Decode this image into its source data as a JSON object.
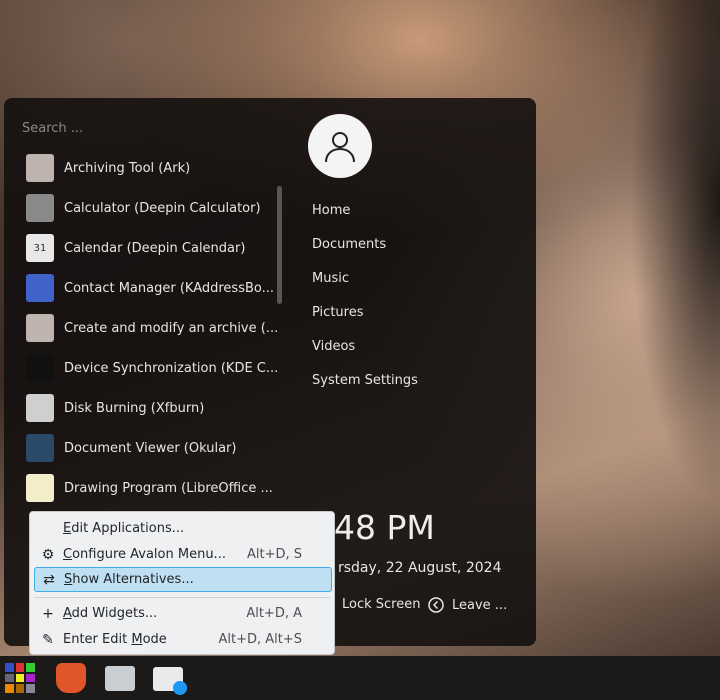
{
  "search": {
    "placeholder": "Search ..."
  },
  "apps": [
    {
      "label": "Archiving Tool (Ark)",
      "icon": "archive-icon",
      "color": "#bfb3ad"
    },
    {
      "label": "Calculator (Deepin Calculator)",
      "icon": "calculator-icon",
      "color": "#8a8a8a"
    },
    {
      "label": "Calendar (Deepin Calendar)",
      "icon": "calendar-icon",
      "color": "#e8e8e8",
      "text": "31"
    },
    {
      "label": "Contact Manager (KAddressBo...",
      "icon": "contact-icon",
      "color": "#3f63c9"
    },
    {
      "label": "Create and modify an archive (...",
      "icon": "archive-icon",
      "color": "#bfb3ad"
    },
    {
      "label": "Device Synchronization (KDE C...",
      "icon": "kde-connect-icon",
      "color": "#111111"
    },
    {
      "label": "Disk Burning (Xfburn)",
      "icon": "disc-icon",
      "color": "#cfcfcf"
    },
    {
      "label": "Document Viewer (Okular)",
      "icon": "okular-icon",
      "color": "#2a4a6a"
    },
    {
      "label": "Drawing Program (LibreOffice ...",
      "icon": "libreoffice-draw-icon",
      "color": "#f3edc8"
    }
  ],
  "user": {
    "icon": "user-icon"
  },
  "places": [
    "Home",
    "Documents",
    "Music",
    "Pictures",
    "Videos",
    "System Settings"
  ],
  "clock": {
    "time": "48 PM",
    "date": "rsday, 22 August, 2024"
  },
  "actions": {
    "lock": "Lock Screen",
    "leave": "Leave ..."
  },
  "context_menu": [
    {
      "pre": "",
      "ul": "E",
      "post": "dit Applications...",
      "shortcut": "",
      "icon": ""
    },
    {
      "pre": "",
      "ul": "C",
      "post": "onfigure Avalon Menu...",
      "shortcut": "Alt+D, S",
      "icon": "gear-icon"
    },
    {
      "pre": "",
      "ul": "S",
      "post": "how Alternatives...",
      "shortcut": "",
      "icon": "alternatives-icon",
      "highlighted": true
    },
    {
      "pre": "",
      "ul": "A",
      "post": "dd Widgets...",
      "shortcut": "Alt+D, A",
      "icon": "plus-icon"
    },
    {
      "pre": "Enter Edit ",
      "ul": "M",
      "post": "ode",
      "shortcut": "Alt+D, Alt+S",
      "icon": "pencil-icon"
    }
  ],
  "taskbar": [
    "app-launcher-icon",
    "brave-browser-icon",
    "file-manager-icon",
    "discover-store-icon"
  ],
  "colors": {
    "highlight": "#bfdff2",
    "highlight_border": "#3daee9",
    "menu_bg": "#eff0f1"
  }
}
